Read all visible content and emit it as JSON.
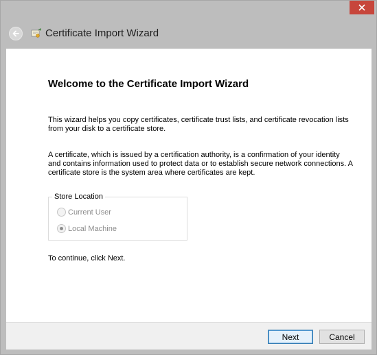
{
  "window": {
    "close_icon": "close-icon",
    "back_icon": "back-arrow-icon",
    "wizard_icon": "certificate-wizard-icon",
    "title": "Certificate Import Wizard"
  },
  "main": {
    "heading": "Welcome to the Certificate Import Wizard",
    "intro_text": "This wizard helps you copy certificates, certificate trust lists, and certificate revocation lists from your disk to a certificate store.",
    "description_text": "A certificate, which is issued by a certification authority, is a confirmation of your identity and contains information used to protect data or to establish secure network connections. A certificate store is the system area where certificates are kept.",
    "store_location": {
      "legend": "Store Location",
      "options": [
        {
          "label": "Current User",
          "selected": false,
          "enabled": false
        },
        {
          "label": "Local Machine",
          "selected": true,
          "enabled": false
        }
      ]
    },
    "continue_text": "To continue, click Next."
  },
  "footer": {
    "next_label": "Next",
    "cancel_label": "Cancel"
  },
  "colors": {
    "close_button": "#c7463b",
    "chrome": "#bdbdbd",
    "content_bg": "#ffffff",
    "footer_bg": "#f0f0f0",
    "default_button_border": "#3c7fb1"
  }
}
